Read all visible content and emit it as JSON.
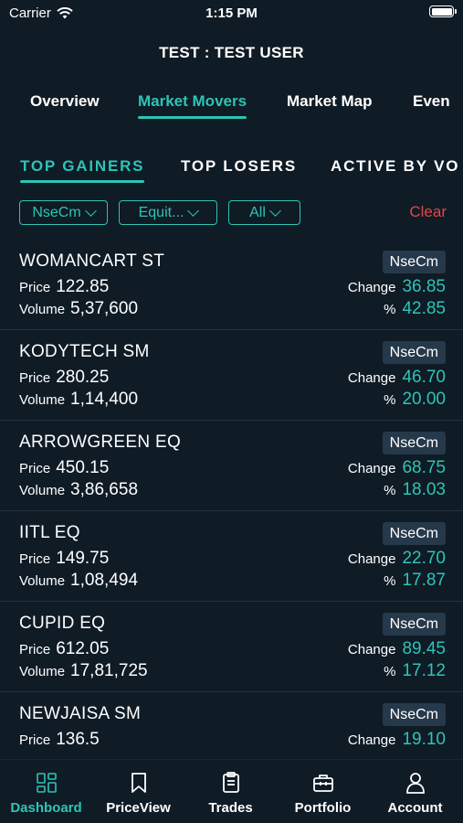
{
  "status_bar": {
    "carrier": "Carrier",
    "time": "1:15 PM"
  },
  "header": {
    "title": "TEST : TEST USER"
  },
  "main_tabs": [
    {
      "label": "Overview"
    },
    {
      "label": "Market Movers",
      "active": true
    },
    {
      "label": "Market Map"
    },
    {
      "label": "Even"
    }
  ],
  "sub_tabs": [
    {
      "label": "TOP GAINERS",
      "active": true
    },
    {
      "label": "TOP LOSERS"
    },
    {
      "label": "ACTIVE BY VO"
    }
  ],
  "filters": {
    "exchange": "NseCm",
    "segment": "Equit...",
    "scope": "All",
    "clear_label": "Clear"
  },
  "labels": {
    "price": "Price",
    "volume": "Volume",
    "change": "Change",
    "percent": "%"
  },
  "stocks": [
    {
      "symbol": "WOMANCART ST",
      "exchange": "NseCm",
      "price": "122.85",
      "volume": "5,37,600",
      "change": "36.85",
      "percent": "42.85"
    },
    {
      "symbol": "KODYTECH SM",
      "exchange": "NseCm",
      "price": "280.25",
      "volume": "1,14,400",
      "change": "46.70",
      "percent": "20.00"
    },
    {
      "symbol": "ARROWGREEN EQ",
      "exchange": "NseCm",
      "price": "450.15",
      "volume": "3,86,658",
      "change": "68.75",
      "percent": "18.03"
    },
    {
      "symbol": "IITL EQ",
      "exchange": "NseCm",
      "price": "149.75",
      "volume": "1,08,494",
      "change": "22.70",
      "percent": "17.87"
    },
    {
      "symbol": "CUPID EQ",
      "exchange": "NseCm",
      "price": "612.05",
      "volume": "17,81,725",
      "change": "89.45",
      "percent": "17.12"
    },
    {
      "symbol": "NEWJAISA SM",
      "exchange": "NseCm",
      "price": "136.5",
      "change": "19.10"
    }
  ],
  "bottom_nav": [
    {
      "label": "Dashboard",
      "icon": "dashboard-icon",
      "active": true
    },
    {
      "label": "PriceView",
      "icon": "bookmark-icon"
    },
    {
      "label": "Trades",
      "icon": "clipboard-icon"
    },
    {
      "label": "Portfolio",
      "icon": "briefcase-icon"
    },
    {
      "label": "Account",
      "icon": "user-icon"
    }
  ],
  "colors": {
    "accent": "#2ec4b6",
    "danger": "#e0464c",
    "background": "#0f1b25",
    "badge": "#26394a"
  }
}
